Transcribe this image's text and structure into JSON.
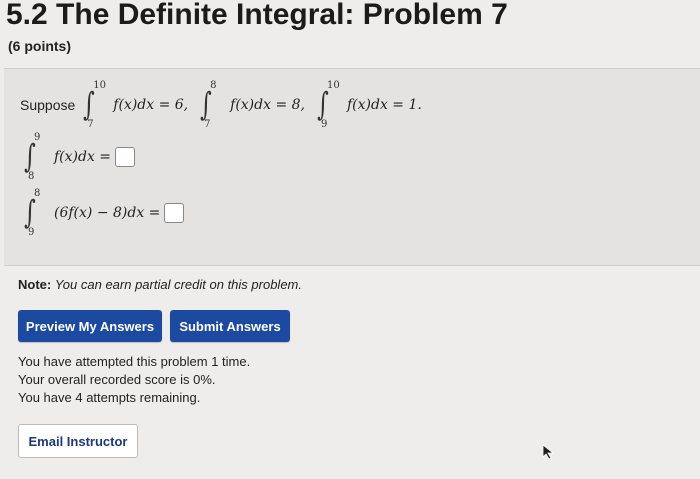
{
  "header": {
    "title": "5.2 The Definite Integral: Problem 7",
    "points": "(6 points)"
  },
  "problem": {
    "suppose": "Suppose",
    "given": [
      {
        "upper": "10",
        "lower": "7",
        "integrand": "f(x)dx = 6,"
      },
      {
        "upper": "8",
        "lower": "7",
        "integrand": "f(x)dx = 8,"
      },
      {
        "upper": "10",
        "lower": "9",
        "integrand": "f(x)dx = 1."
      }
    ],
    "questions": [
      {
        "upper": "9",
        "lower": "8",
        "integrand": "f(x)dx =",
        "answer": ""
      },
      {
        "upper": "8",
        "lower": "9",
        "integrand": "(6f(x) − 8)dx =",
        "answer": ""
      }
    ]
  },
  "note": {
    "label": "Note:",
    "text": "You can earn partial credit on this problem."
  },
  "buttons": {
    "preview": "Preview My Answers",
    "submit": "Submit Answers",
    "email": "Email Instructor"
  },
  "status": {
    "attempted": "You have attempted this problem 1 time.",
    "score": "Your overall recorded score is 0%.",
    "remaining": "You have 4 attempts remaining."
  },
  "colors": {
    "primary_button": "#1b4aa0",
    "background": "#eeedec",
    "problem_box": "#e4e3e2"
  }
}
